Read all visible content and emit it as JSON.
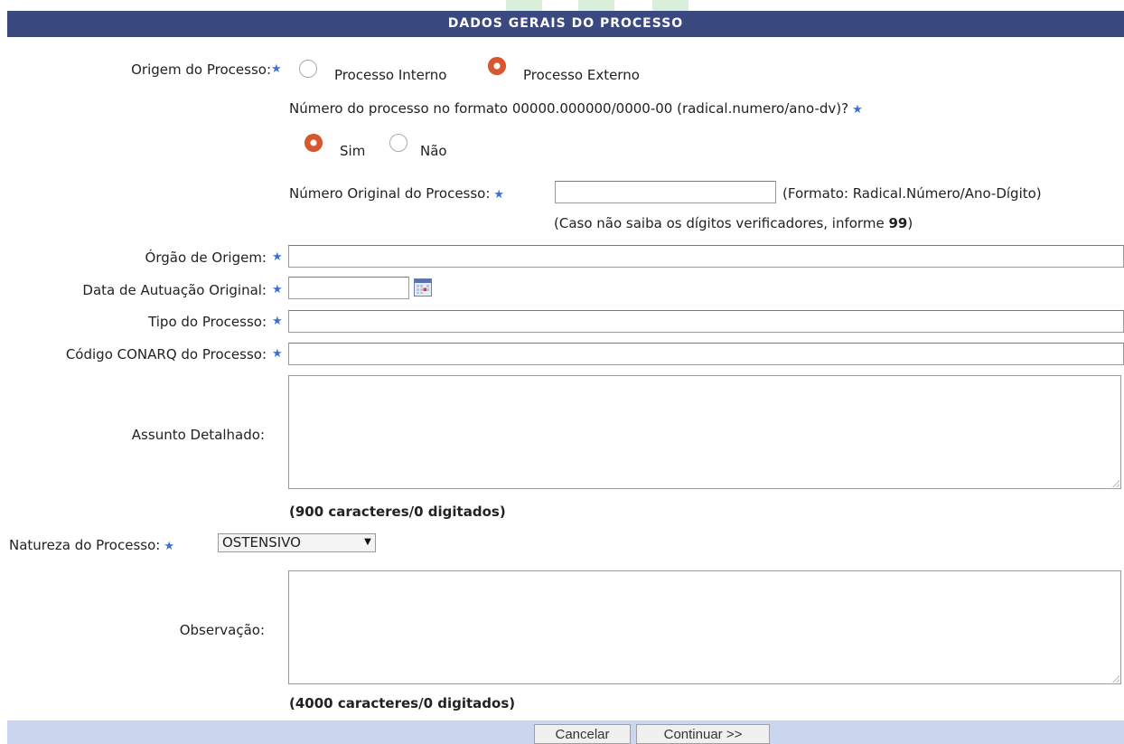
{
  "header": {
    "title": "DADOS GERAIS DO PROCESSO"
  },
  "origem": {
    "label": "Origem do Processo:",
    "options": [
      {
        "label": "Processo Interno",
        "checked": false
      },
      {
        "label": "Processo Externo",
        "checked": true
      }
    ]
  },
  "formato_question": {
    "label": "Número do processo no formato 00000.000000/0000-00 (radical.numero/ano-dv)?",
    "options": [
      {
        "label": "Sim",
        "checked": true
      },
      {
        "label": "Não",
        "checked": false
      }
    ]
  },
  "numero_original": {
    "label": "Número Original do Processo:",
    "value": "",
    "format_hint": "(Formato: Radical.Número/Ano-Dígito)",
    "digits_hint_prefix": "(Caso não saiba os dígitos verificadores, informe ",
    "digits_hint_bold": "99",
    "digits_hint_suffix": ")"
  },
  "orgao_origem": {
    "label": "Órgão de Origem:",
    "value": ""
  },
  "data_autuacao": {
    "label": "Data de Autuação Original:",
    "value": ""
  },
  "tipo_processo": {
    "label": "Tipo do Processo:",
    "value": ""
  },
  "codigo_conarq": {
    "label": "Código CONARQ do Processo:",
    "value": ""
  },
  "assunto": {
    "label": "Assunto Detalhado:",
    "value": "",
    "counter": "(900 caracteres/0 digitados)"
  },
  "natureza": {
    "label": "Natureza do Processo:",
    "selected": "OSTENSIVO"
  },
  "observacao": {
    "label": "Observação:",
    "value": "",
    "counter": "(4000 caracteres/0 digitados)"
  },
  "footer": {
    "cancel_label": "Cancelar",
    "continue_label": "Continuar >>"
  },
  "required_marker": "★",
  "colors": {
    "header_bg": "#3a4a80",
    "footer_bg": "#c9d6ee",
    "radio_checked": "#d8572c",
    "required_star": "#3b6fd8"
  }
}
